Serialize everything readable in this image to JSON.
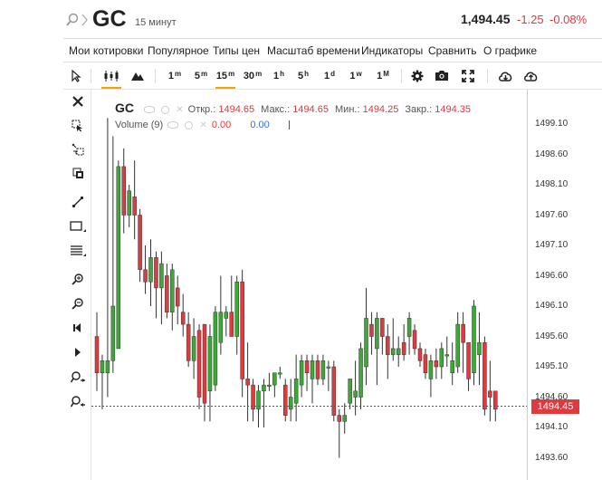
{
  "header": {
    "symbol": "GC",
    "timeframe": "15 минут",
    "last_price": "1,494.45",
    "change_abs": "-1.25",
    "change_pct": "-0.08%"
  },
  "menu": [
    "Мои котировки",
    "Популярное",
    "Типы цен",
    "Масштаб времени",
    "Индикаторы",
    "Сравнить",
    "О графике"
  ],
  "toolbar": {
    "intervals": [
      "1m",
      "5m",
      "15m",
      "30m",
      "1h",
      "5h",
      "1d",
      "1w",
      "1M"
    ],
    "active_interval": "15m",
    "icons": [
      "cursor-icon",
      "candles-icon",
      "mountain-icon",
      "gear-icon",
      "camera-icon",
      "fullscreen-icon",
      "cloud-download-icon",
      "cloud-upload-icon"
    ]
  },
  "left_tools": [
    "close-icon",
    "crosshair-icon",
    "magnet-icon",
    "copy-icon",
    "trendline-icon",
    "rectangle-icon",
    "fibonacci-icon",
    "zoom-in-icon",
    "zoom-out-icon",
    "arrow-left-icon",
    "arrow-right-icon",
    "zoom-area-in-icon",
    "zoom-area-out-icon"
  ],
  "legend": {
    "symbol": "GC",
    "open_label": "Откр.:",
    "open": "1494.65",
    "high_label": "Макс.:",
    "high": "1494.65",
    "low_label": "Мин.:",
    "low": "1494.25",
    "close_label": "Закр.:",
    "close": "1494.35",
    "volume_label": "Volume (9)",
    "volume_val1": "0.00",
    "volume_val2": "0.00"
  },
  "colors": {
    "up": "#3aaa35",
    "down": "#e0393e",
    "accent": "#f0a400"
  },
  "chart_data": {
    "type": "candlestick",
    "ylim": [
      1493.4,
      1499.3
    ],
    "y_ticks": [
      "1499.10",
      "1498.60",
      "1498.10",
      "1497.60",
      "1497.10",
      "1496.60",
      "1496.10",
      "1495.60",
      "1495.10",
      "1494.60",
      "1494.10",
      "1493.60"
    ],
    "current_price": "1494.45",
    "candles": [
      {
        "o": 1495.6,
        "h": 1496.0,
        "l": 1494.7,
        "c": 1495.0
      },
      {
        "o": 1495.0,
        "h": 1495.3,
        "l": 1494.4,
        "c": 1495.2
      },
      {
        "o": 1495.0,
        "h": 1499.2,
        "l": 1494.6,
        "c": 1495.2
      },
      {
        "o": 1495.2,
        "h": 1498.9,
        "l": 1495.0,
        "c": 1496.1
      },
      {
        "o": 1495.4,
        "h": 1498.5,
        "l": 1495.4,
        "c": 1498.4
      },
      {
        "o": 1498.4,
        "h": 1498.7,
        "l": 1497.3,
        "c": 1497.6
      },
      {
        "o": 1497.6,
        "h": 1498.1,
        "l": 1497.4,
        "c": 1498.0
      },
      {
        "o": 1497.9,
        "h": 1498.5,
        "l": 1497.2,
        "c": 1497.6
      },
      {
        "o": 1497.6,
        "h": 1497.7,
        "l": 1496.5,
        "c": 1496.7
      },
      {
        "o": 1496.7,
        "h": 1497.1,
        "l": 1496.3,
        "c": 1496.5
      },
      {
        "o": 1496.5,
        "h": 1497.2,
        "l": 1496.1,
        "c": 1496.9
      },
      {
        "o": 1496.9,
        "h": 1497.0,
        "l": 1495.9,
        "c": 1496.4
      },
      {
        "o": 1496.4,
        "h": 1497.0,
        "l": 1495.8,
        "c": 1496.8
      },
      {
        "o": 1496.6,
        "h": 1496.8,
        "l": 1495.9,
        "c": 1496.0
      },
      {
        "o": 1496.0,
        "h": 1496.8,
        "l": 1495.7,
        "c": 1496.7
      },
      {
        "o": 1496.4,
        "h": 1496.6,
        "l": 1495.8,
        "c": 1496.1
      },
      {
        "o": 1496.0,
        "h": 1496.3,
        "l": 1495.6,
        "c": 1495.8
      },
      {
        "o": 1495.8,
        "h": 1496.0,
        "l": 1495.1,
        "c": 1495.2
      },
      {
        "o": 1495.2,
        "h": 1495.9,
        "l": 1494.9,
        "c": 1495.6
      },
      {
        "o": 1495.7,
        "h": 1495.8,
        "l": 1494.4,
        "c": 1494.6
      },
      {
        "o": 1495.8,
        "h": 1495.8,
        "l": 1494.2,
        "c": 1494.5
      },
      {
        "o": 1494.7,
        "h": 1495.8,
        "l": 1494.2,
        "c": 1495.6
      },
      {
        "o": 1494.8,
        "h": 1496.1,
        "l": 1494.7,
        "c": 1496.0
      },
      {
        "o": 1495.5,
        "h": 1496.6,
        "l": 1495.3,
        "c": 1496.0
      },
      {
        "o": 1495.9,
        "h": 1496.1,
        "l": 1495.6,
        "c": 1496.0
      },
      {
        "o": 1496.0,
        "h": 1496.6,
        "l": 1495.7,
        "c": 1495.6
      },
      {
        "o": 1495.6,
        "h": 1496.6,
        "l": 1495.3,
        "c": 1496.5
      },
      {
        "o": 1496.5,
        "h": 1496.7,
        "l": 1494.6,
        "c": 1494.9
      },
      {
        "o": 1494.9,
        "h": 1495.5,
        "l": 1494.2,
        "c": 1494.8
      },
      {
        "o": 1494.8,
        "h": 1494.9,
        "l": 1494.2,
        "c": 1494.4
      },
      {
        "o": 1494.4,
        "h": 1494.8,
        "l": 1494.1,
        "c": 1494.7
      },
      {
        "o": 1494.7,
        "h": 1494.9,
        "l": 1494.1,
        "c": 1494.8
      },
      {
        "o": 1494.8,
        "h": 1495.0,
        "l": 1494.7,
        "c": 1494.8
      },
      {
        "o": 1494.8,
        "h": 1495.0,
        "l": 1494.6,
        "c": 1495.0
      },
      {
        "o": 1495.0,
        "h": 1495.1,
        "l": 1494.9,
        "c": 1495.0
      },
      {
        "o": 1494.8,
        "h": 1494.9,
        "l": 1494.2,
        "c": 1494.3
      },
      {
        "o": 1494.4,
        "h": 1494.9,
        "l": 1494.2,
        "c": 1494.6
      },
      {
        "o": 1494.5,
        "h": 1495.3,
        "l": 1494.2,
        "c": 1494.9
      },
      {
        "o": 1494.8,
        "h": 1495.3,
        "l": 1494.6,
        "c": 1495.2
      },
      {
        "o": 1495.2,
        "h": 1495.3,
        "l": 1494.7,
        "c": 1495.0
      },
      {
        "o": 1494.9,
        "h": 1495.3,
        "l": 1494.5,
        "c": 1495.2
      },
      {
        "o": 1495.2,
        "h": 1495.3,
        "l": 1494.8,
        "c": 1494.9
      },
      {
        "o": 1494.9,
        "h": 1495.3,
        "l": 1494.8,
        "c": 1495.2
      },
      {
        "o": 1495.1,
        "h": 1495.2,
        "l": 1494.7,
        "c": 1495.1
      },
      {
        "o": 1495.1,
        "h": 1495.2,
        "l": 1494.2,
        "c": 1494.3
      },
      {
        "o": 1494.3,
        "h": 1494.4,
        "l": 1493.6,
        "c": 1494.2
      },
      {
        "o": 1494.2,
        "h": 1494.5,
        "l": 1494.0,
        "c": 1494.3
      },
      {
        "o": 1494.5,
        "h": 1494.9,
        "l": 1494.4,
        "c": 1494.9
      },
      {
        "o": 1494.6,
        "h": 1495.2,
        "l": 1494.3,
        "c": 1494.7
      },
      {
        "o": 1494.6,
        "h": 1495.5,
        "l": 1494.4,
        "c": 1495.4
      },
      {
        "o": 1495.1,
        "h": 1496.4,
        "l": 1494.8,
        "c": 1495.9
      },
      {
        "o": 1495.8,
        "h": 1496.0,
        "l": 1495.3,
        "c": 1495.6
      },
      {
        "o": 1495.4,
        "h": 1496.0,
        "l": 1494.8,
        "c": 1495.9
      },
      {
        "o": 1495.9,
        "h": 1495.9,
        "l": 1495.3,
        "c": 1495.6
      },
      {
        "o": 1495.6,
        "h": 1495.8,
        "l": 1494.9,
        "c": 1495.3
      },
      {
        "o": 1495.3,
        "h": 1495.9,
        "l": 1495.2,
        "c": 1495.4
      },
      {
        "o": 1495.3,
        "h": 1495.6,
        "l": 1495.1,
        "c": 1495.4
      },
      {
        "o": 1495.5,
        "h": 1495.8,
        "l": 1495.2,
        "c": 1495.3
      },
      {
        "o": 1495.6,
        "h": 1496.0,
        "l": 1495.3,
        "c": 1495.9
      },
      {
        "o": 1495.7,
        "h": 1495.8,
        "l": 1495.3,
        "c": 1495.4
      },
      {
        "o": 1495.4,
        "h": 1495.5,
        "l": 1495.1,
        "c": 1495.2
      },
      {
        "o": 1495.3,
        "h": 1495.4,
        "l": 1494.9,
        "c": 1495.0
      },
      {
        "o": 1494.9,
        "h": 1495.3,
        "l": 1494.6,
        "c": 1495.2
      },
      {
        "o": 1495.2,
        "h": 1495.4,
        "l": 1494.9,
        "c": 1495.1
      },
      {
        "o": 1495.1,
        "h": 1495.5,
        "l": 1494.9,
        "c": 1495.4
      },
      {
        "o": 1495.3,
        "h": 1495.6,
        "l": 1495.1,
        "c": 1495.3
      },
      {
        "o": 1495.0,
        "h": 1495.5,
        "l": 1494.8,
        "c": 1495.2
      },
      {
        "o": 1495.1,
        "h": 1496.0,
        "l": 1495.0,
        "c": 1495.8
      },
      {
        "o": 1495.8,
        "h": 1496.0,
        "l": 1495.0,
        "c": 1495.5
      },
      {
        "o": 1495.5,
        "h": 1495.5,
        "l": 1494.7,
        "c": 1494.9
      },
      {
        "o": 1495.0,
        "h": 1496.2,
        "l": 1494.8,
        "c": 1496.1
      },
      {
        "o": 1495.3,
        "h": 1496.0,
        "l": 1494.8,
        "c": 1495.5
      },
      {
        "o": 1495.5,
        "h": 1495.6,
        "l": 1494.3,
        "c": 1494.4
      },
      {
        "o": 1494.7,
        "h": 1495.2,
        "l": 1494.2,
        "c": 1494.6
      },
      {
        "o": 1494.7,
        "h": 1494.7,
        "l": 1494.2,
        "c": 1494.4
      }
    ]
  }
}
